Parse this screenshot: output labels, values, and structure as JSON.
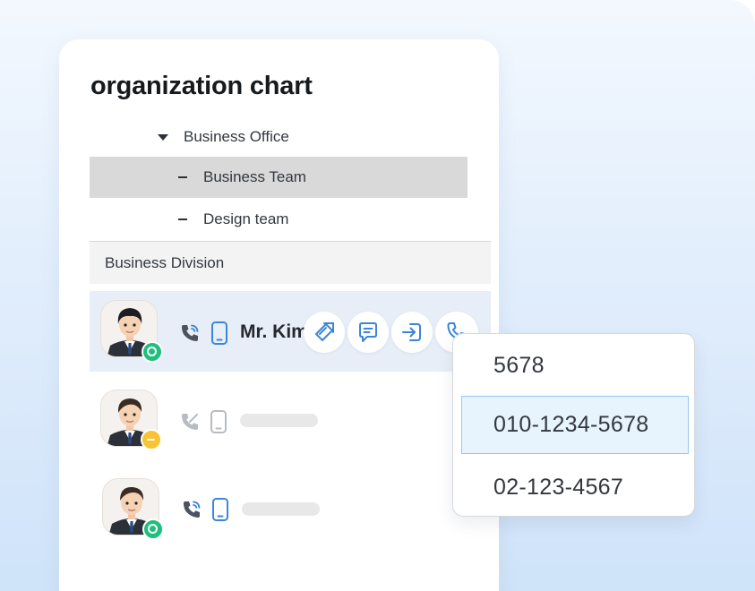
{
  "panel": {
    "title": "organization chart"
  },
  "tree": {
    "office": "Business Office",
    "teams": [
      "Business Team",
      "Design team"
    ],
    "division": "Business Division"
  },
  "members": [
    {
      "name": "Mr. Kim",
      "status": "online",
      "active": true
    },
    {
      "name": "",
      "status": "away",
      "active": false
    },
    {
      "name": "",
      "status": "online",
      "active": false
    }
  ],
  "actions": [
    "send-file-icon",
    "chat-icon",
    "share-icon",
    "call-icon"
  ],
  "phone_dropdown": {
    "options": [
      "5678",
      "010-1234-5678",
      "02-123-4567"
    ],
    "selected": "010-1234-5678"
  },
  "colors": {
    "online": "#1fbf7d",
    "away": "#f7c533",
    "accent": "#3b86d6",
    "selected_row": "#d9d9d9",
    "active_member": "#e8eef7"
  }
}
